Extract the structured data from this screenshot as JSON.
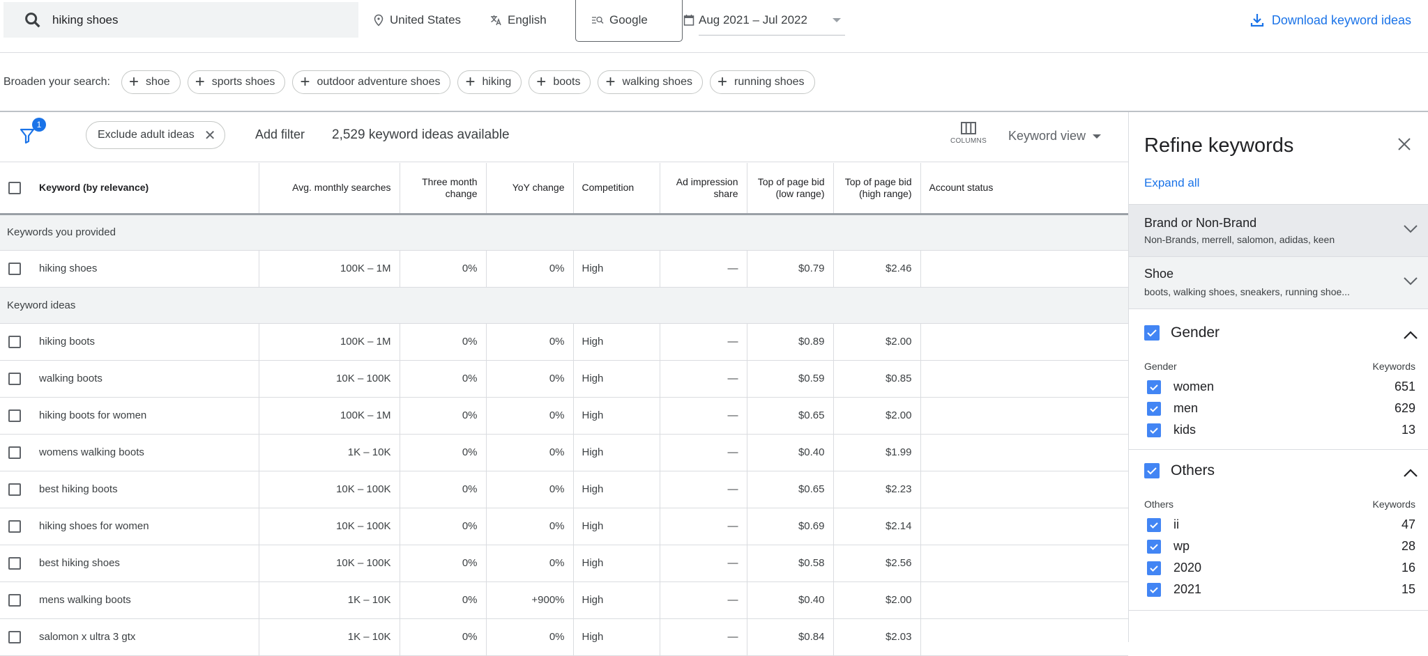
{
  "topbar": {
    "search_query": "hiking shoes",
    "location": "United States",
    "language": "English",
    "network": "Google",
    "date_range": "Aug 2021 – Jul 2022",
    "download_label": "Download keyword ideas"
  },
  "broaden": {
    "label": "Broaden your search:",
    "chips": [
      "shoe",
      "sports shoes",
      "outdoor adventure shoes",
      "hiking",
      "boots",
      "walking shoes",
      "running shoes"
    ]
  },
  "toolbar": {
    "filter_badge": "1",
    "exclude_chip": "Exclude adult ideas",
    "add_filter": "Add filter",
    "count": "2,529 keyword ideas available",
    "columns_label": "COLUMNS",
    "view_label": "Keyword view"
  },
  "table": {
    "headers": [
      "Keyword (by relevance)",
      "Avg. monthly searches",
      "Three month change",
      "YoY change",
      "Competition",
      "Ad impression share",
      "Top of page bid (low range)",
      "Top of page bid (high range)",
      "Account status"
    ],
    "group_provided": "Keywords you provided",
    "provided": [
      {
        "keyword": "hiking shoes",
        "searches": "100K – 1M",
        "three_month": "0%",
        "yoy": "0%",
        "competition": "High",
        "impression": "—",
        "bid_low": "$0.79",
        "bid_high": "$2.46",
        "status": ""
      }
    ],
    "group_ideas": "Keyword ideas",
    "ideas": [
      {
        "keyword": "hiking boots",
        "searches": "100K – 1M",
        "three_month": "0%",
        "yoy": "0%",
        "competition": "High",
        "impression": "—",
        "bid_low": "$0.89",
        "bid_high": "$2.00",
        "status": ""
      },
      {
        "keyword": "walking boots",
        "searches": "10K – 100K",
        "three_month": "0%",
        "yoy": "0%",
        "competition": "High",
        "impression": "—",
        "bid_low": "$0.59",
        "bid_high": "$0.85",
        "status": ""
      },
      {
        "keyword": "hiking boots for women",
        "searches": "100K – 1M",
        "three_month": "0%",
        "yoy": "0%",
        "competition": "High",
        "impression": "—",
        "bid_low": "$0.65",
        "bid_high": "$2.00",
        "status": ""
      },
      {
        "keyword": "womens walking boots",
        "searches": "1K – 10K",
        "three_month": "0%",
        "yoy": "0%",
        "competition": "High",
        "impression": "—",
        "bid_low": "$0.40",
        "bid_high": "$1.99",
        "status": ""
      },
      {
        "keyword": "best hiking boots",
        "searches": "10K – 100K",
        "three_month": "0%",
        "yoy": "0%",
        "competition": "High",
        "impression": "—",
        "bid_low": "$0.65",
        "bid_high": "$2.23",
        "status": ""
      },
      {
        "keyword": "hiking shoes for women",
        "searches": "10K – 100K",
        "three_month": "0%",
        "yoy": "0%",
        "competition": "High",
        "impression": "—",
        "bid_low": "$0.69",
        "bid_high": "$2.14",
        "status": ""
      },
      {
        "keyword": "best hiking shoes",
        "searches": "10K – 100K",
        "three_month": "0%",
        "yoy": "0%",
        "competition": "High",
        "impression": "—",
        "bid_low": "$0.58",
        "bid_high": "$2.56",
        "status": ""
      },
      {
        "keyword": "mens walking boots",
        "searches": "1K – 10K",
        "three_month": "0%",
        "yoy": "+900%",
        "competition": "High",
        "impression": "—",
        "bid_low": "$0.40",
        "bid_high": "$2.00",
        "status": ""
      },
      {
        "keyword": "salomon x ultra 3 gtx",
        "searches": "1K – 10K",
        "three_month": "0%",
        "yoy": "0%",
        "competition": "High",
        "impression": "—",
        "bid_low": "$0.84",
        "bid_high": "$2.03",
        "status": ""
      }
    ]
  },
  "refine": {
    "title": "Refine keywords",
    "expand_all": "Expand all",
    "brand": {
      "title": "Brand or Non-Brand",
      "summary": "Non-Brands, merrell, salomon, adidas, keen"
    },
    "shoe": {
      "title": "Shoe",
      "summary": "boots, walking shoes, sneakers, running shoe..."
    },
    "gender": {
      "title": "Gender",
      "col_label": "Gender",
      "col_count": "Keywords",
      "options": [
        {
          "label": "women",
          "count": "651"
        },
        {
          "label": "men",
          "count": "629"
        },
        {
          "label": "kids",
          "count": "13"
        }
      ]
    },
    "others": {
      "title": "Others",
      "col_label": "Others",
      "col_count": "Keywords",
      "options": [
        {
          "label": "ii",
          "count": "47"
        },
        {
          "label": "wp",
          "count": "28"
        },
        {
          "label": "2020",
          "count": "16"
        },
        {
          "label": "2021",
          "count": "15"
        }
      ]
    }
  },
  "colors": {
    "accent": "#1a73e8",
    "checkbox": "#4285f4"
  }
}
